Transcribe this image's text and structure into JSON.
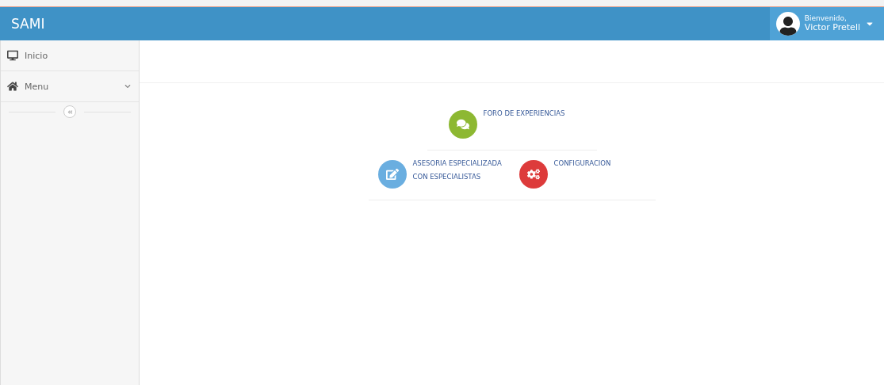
{
  "brand": "SAMI",
  "user": {
    "greeting": "Bienvenido,",
    "name": "Victor Pretell"
  },
  "sidebar": {
    "items": [
      {
        "label": "Inicio",
        "kind": "monitor",
        "expandable": false
      },
      {
        "label": "Menu",
        "kind": "home",
        "expandable": true
      }
    ]
  },
  "tile_rows": [
    [
      {
        "kind": "chat",
        "color": "#8db832",
        "lines": [
          "FORO DE EXPERIENCIAS"
        ]
      }
    ],
    [
      {
        "kind": "edit",
        "color": "#6aaee0",
        "lines": [
          "ASESORIA ESPECIALIZADA",
          "CON ESPECIALISTAS"
        ]
      },
      {
        "kind": "gears",
        "color": "#dd3b3b",
        "lines": [
          "CONFIGURACION"
        ]
      }
    ]
  ]
}
